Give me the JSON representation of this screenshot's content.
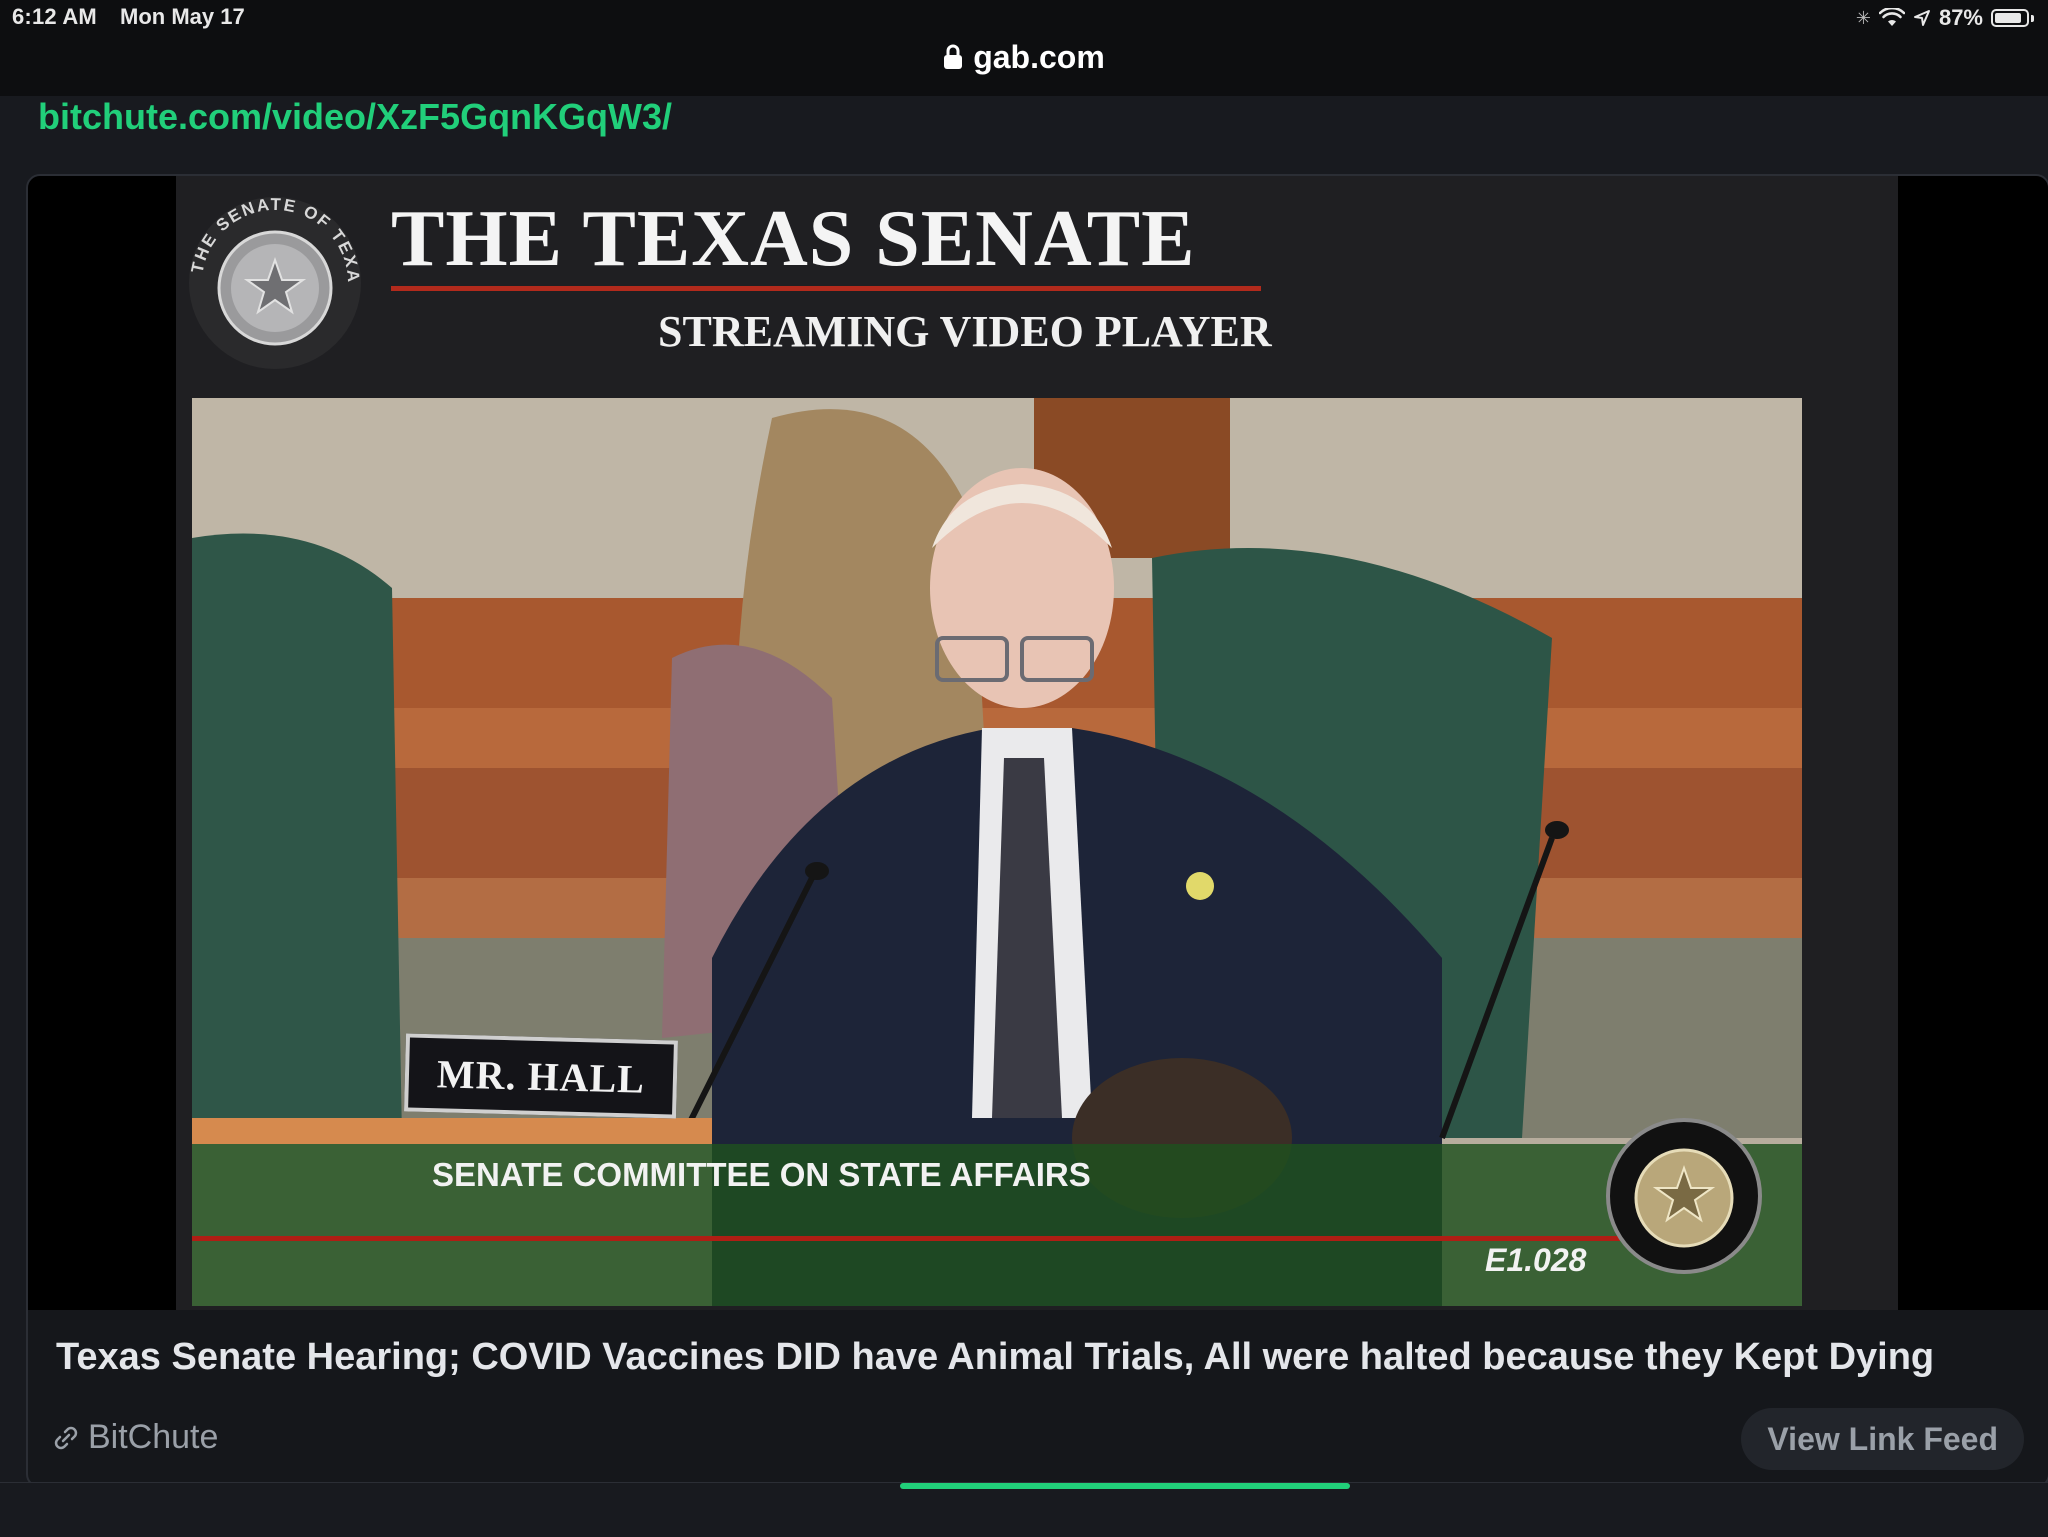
{
  "status_bar": {
    "time": "6:12 AM",
    "date": "Mon May 17",
    "battery_text": "87%",
    "battery_level": 0.87
  },
  "browser": {
    "url": "gab.com"
  },
  "post": {
    "link_text": "bitchute.com/video/XzF5GqnKGqW3/",
    "card": {
      "video": {
        "header_title": "THE TEXAS SENATE",
        "header_subtitle": "STREAMING VIDEO PLAYER",
        "seal_text": "THE SENATE OF TEXAS",
        "nameplate": "MR. HALL",
        "lower_third": "SENATE COMMITTEE ON STATE AFFAIRS",
        "code": "E1.028"
      },
      "title": "Texas Senate Hearing; COVID Vaccines DID have Animal Trials, All were halted because they Kept Dying",
      "source": "BitChute",
      "view_feed_label": "View Link Feed"
    }
  },
  "colors": {
    "accent": "#21cf7a",
    "background": "#181a1f",
    "card_background": "#15171b",
    "muted_text": "#9aa0a8"
  }
}
